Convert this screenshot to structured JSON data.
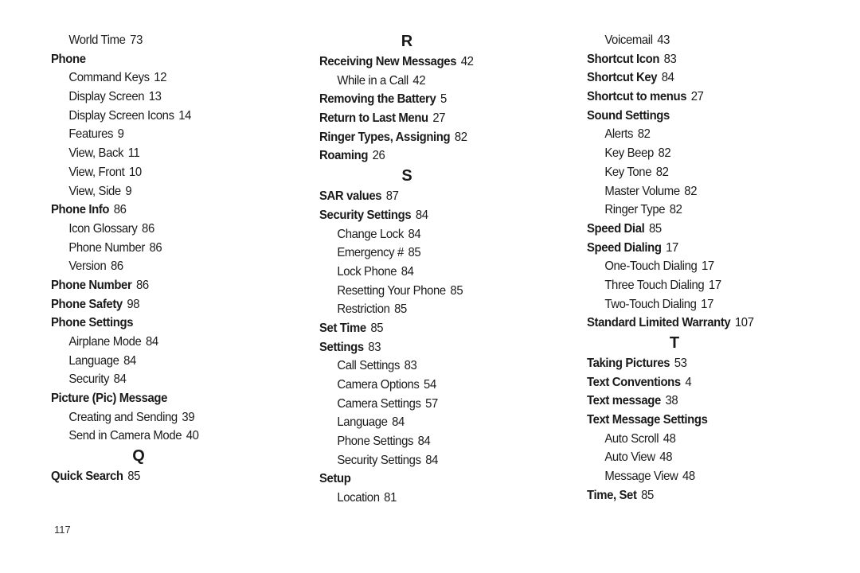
{
  "page_number": "117",
  "columns": [
    {
      "entries": [
        {
          "type": "sub",
          "term": "World Time",
          "page": "73"
        },
        {
          "type": "main",
          "term": "Phone",
          "page": ""
        },
        {
          "type": "sub",
          "term": "Command Keys",
          "page": "12"
        },
        {
          "type": "sub",
          "term": "Display Screen",
          "page": "13"
        },
        {
          "type": "sub",
          "term": "Display Screen Icons",
          "page": "14"
        },
        {
          "type": "sub",
          "term": "Features",
          "page": "9"
        },
        {
          "type": "sub",
          "term": "View, Back",
          "page": "11"
        },
        {
          "type": "sub",
          "term": "View, Front",
          "page": "10"
        },
        {
          "type": "sub",
          "term": "View, Side",
          "page": "9"
        },
        {
          "type": "main",
          "term": "Phone Info",
          "page": "86"
        },
        {
          "type": "sub",
          "term": "Icon Glossary",
          "page": "86"
        },
        {
          "type": "sub",
          "term": "Phone Number",
          "page": "86"
        },
        {
          "type": "sub",
          "term": "Version",
          "page": "86"
        },
        {
          "type": "main",
          "term": "Phone Number",
          "page": "86"
        },
        {
          "type": "main",
          "term": "Phone Safety",
          "page": "98"
        },
        {
          "type": "main",
          "term": "Phone Settings",
          "page": ""
        },
        {
          "type": "sub",
          "term": "Airplane Mode",
          "page": "84"
        },
        {
          "type": "sub",
          "term": "Language",
          "page": "84"
        },
        {
          "type": "sub",
          "term": "Security",
          "page": "84"
        },
        {
          "type": "main",
          "term": "Picture (Pic) Message",
          "page": ""
        },
        {
          "type": "sub",
          "term": "Creating and Sending",
          "page": "39"
        },
        {
          "type": "sub",
          "term": "Send in Camera Mode",
          "page": "40"
        },
        {
          "type": "letter",
          "term": "Q",
          "page": ""
        },
        {
          "type": "main",
          "term": "Quick Search",
          "page": "85"
        }
      ]
    },
    {
      "entries": [
        {
          "type": "letter",
          "term": "R",
          "page": ""
        },
        {
          "type": "main",
          "term": "Receiving New Messages",
          "page": "42"
        },
        {
          "type": "sub",
          "term": "While in a Call",
          "page": "42"
        },
        {
          "type": "main",
          "term": "Removing the Battery",
          "page": "5"
        },
        {
          "type": "main",
          "term": "Return to Last Menu",
          "page": "27"
        },
        {
          "type": "main",
          "term": "Ringer Types, Assigning",
          "page": "82"
        },
        {
          "type": "main",
          "term": "Roaming",
          "page": "26"
        },
        {
          "type": "letter",
          "term": "S",
          "page": ""
        },
        {
          "type": "main",
          "term": "SAR values",
          "page": "87"
        },
        {
          "type": "main",
          "term": "Security Settings",
          "page": "84"
        },
        {
          "type": "sub",
          "term": "Change Lock",
          "page": "84"
        },
        {
          "type": "sub",
          "term": "Emergency #",
          "page": "85"
        },
        {
          "type": "sub",
          "term": "Lock Phone",
          "page": "84"
        },
        {
          "type": "sub",
          "term": "Resetting Your Phone",
          "page": "85"
        },
        {
          "type": "sub",
          "term": "Restriction",
          "page": "85"
        },
        {
          "type": "main",
          "term": "Set Time",
          "page": "85"
        },
        {
          "type": "main",
          "term": "Settings",
          "page": "83"
        },
        {
          "type": "sub",
          "term": "Call Settings",
          "page": "83"
        },
        {
          "type": "sub",
          "term": "Camera Options",
          "page": "54"
        },
        {
          "type": "sub",
          "term": "Camera Settings",
          "page": "57"
        },
        {
          "type": "sub",
          "term": "Language",
          "page": "84"
        },
        {
          "type": "sub",
          "term": "Phone Settings",
          "page": "84"
        },
        {
          "type": "sub",
          "term": "Security Settings",
          "page": "84"
        },
        {
          "type": "main",
          "term": "Setup",
          "page": ""
        },
        {
          "type": "sub",
          "term": "Location",
          "page": "81"
        }
      ]
    },
    {
      "entries": [
        {
          "type": "sub",
          "term": "Voicemail",
          "page": "43"
        },
        {
          "type": "main",
          "term": "Shortcut Icon",
          "page": "83"
        },
        {
          "type": "main",
          "term": "Shortcut Key",
          "page": "84"
        },
        {
          "type": "main",
          "term": "Shortcut to menus",
          "page": "27"
        },
        {
          "type": "main",
          "term": "Sound Settings",
          "page": ""
        },
        {
          "type": "sub",
          "term": "Alerts",
          "page": "82"
        },
        {
          "type": "sub",
          "term": "Key Beep",
          "page": "82"
        },
        {
          "type": "sub",
          "term": "Key Tone",
          "page": "82"
        },
        {
          "type": "sub",
          "term": "Master Volume",
          "page": "82"
        },
        {
          "type": "sub",
          "term": "Ringer Type",
          "page": "82"
        },
        {
          "type": "main",
          "term": "Speed Dial",
          "page": "85"
        },
        {
          "type": "main",
          "term": "Speed Dialing",
          "page": "17"
        },
        {
          "type": "sub",
          "term": "One-Touch Dialing",
          "page": "17"
        },
        {
          "type": "sub",
          "term": "Three Touch Dialing",
          "page": "17"
        },
        {
          "type": "sub",
          "term": "Two-Touch Dialing",
          "page": "17"
        },
        {
          "type": "main",
          "term": "Standard Limited Warranty",
          "page": "107"
        },
        {
          "type": "letter",
          "term": "T",
          "page": ""
        },
        {
          "type": "main",
          "term": "Taking Pictures",
          "page": "53"
        },
        {
          "type": "main",
          "term": "Text Conventions",
          "page": "4"
        },
        {
          "type": "main",
          "term": "Text message",
          "page": "38"
        },
        {
          "type": "main",
          "term": "Text Message Settings",
          "page": ""
        },
        {
          "type": "sub",
          "term": "Auto Scroll",
          "page": "48"
        },
        {
          "type": "sub",
          "term": "Auto View",
          "page": "48"
        },
        {
          "type": "sub",
          "term": "Message View",
          "page": "48"
        },
        {
          "type": "main",
          "term": "Time, Set",
          "page": "85"
        }
      ]
    }
  ]
}
